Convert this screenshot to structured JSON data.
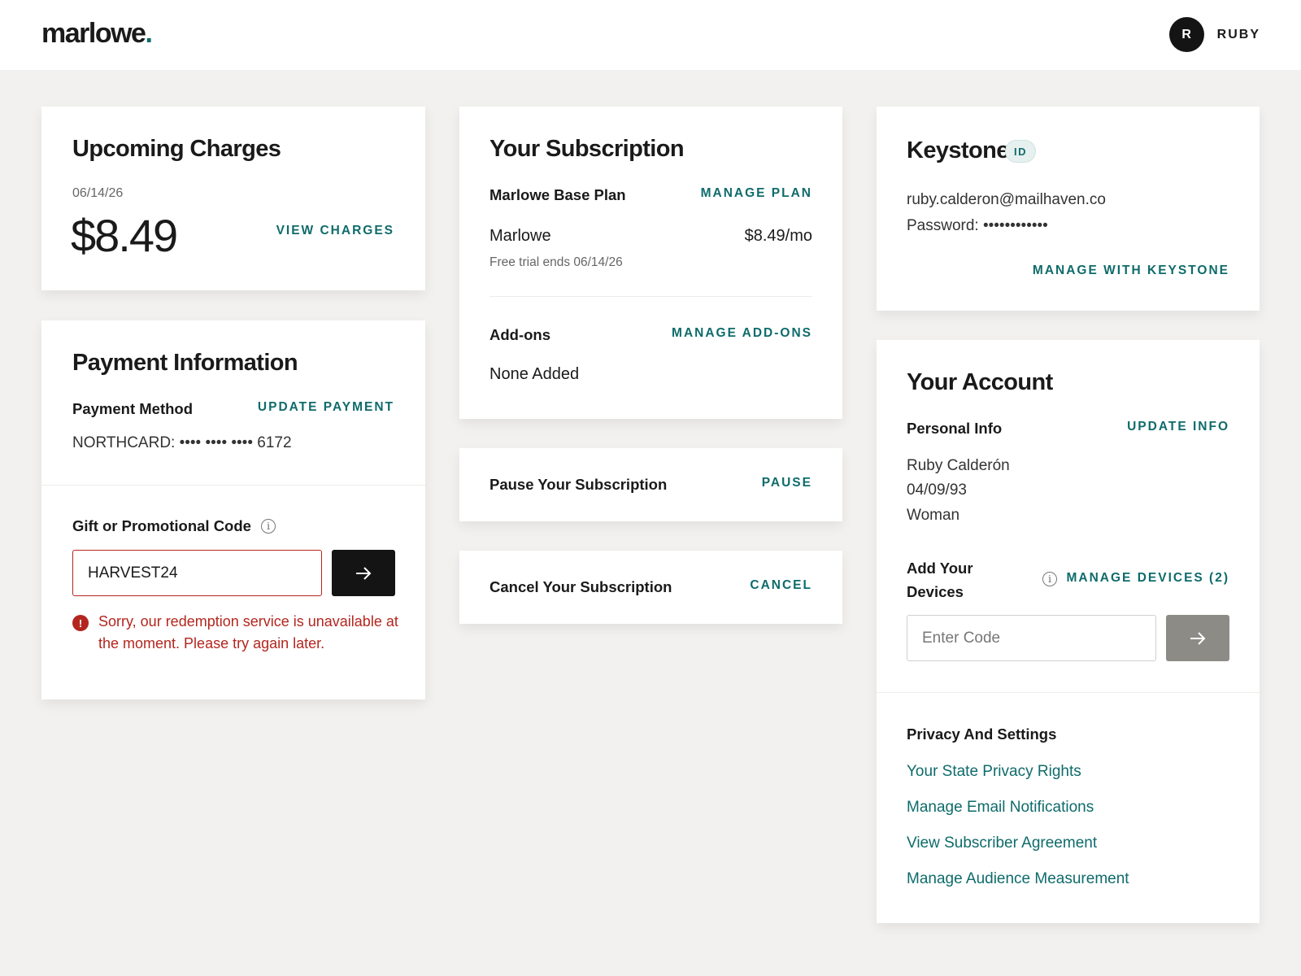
{
  "header": {
    "logo_text": "marlowe",
    "logo_dot": ".",
    "avatar_initial": "R",
    "user_name": "RUBY"
  },
  "upcoming_charges": {
    "title": "Upcoming Charges",
    "date": "06/14/26",
    "amount": "$8.49",
    "view_charges": "VIEW CHARGES"
  },
  "payment": {
    "title": "Payment Information",
    "method_label": "Payment Method",
    "update_payment": "UPDATE PAYMENT",
    "card_text": "NORTHCARD: •••• •••• •••• 6172",
    "promo_label": "Gift or Promotional Code",
    "promo_value": "HARVEST24",
    "error_message": "Sorry, our redemption service is unavailable at the moment. Please try again later."
  },
  "subscription": {
    "title": "Your Subscription",
    "plan_label": "Marlowe Base Plan",
    "manage_plan": "MANAGE PLAN",
    "plan_name": "Marlowe",
    "plan_price": "$8.49/mo",
    "trial_note": "Free trial ends 06/14/26",
    "addons_label": "Add-ons",
    "manage_addons": "MANAGE ADD-ONS",
    "addons_value": "None Added"
  },
  "pause": {
    "label": "Pause Your Subscription",
    "action": "PAUSE"
  },
  "cancel": {
    "label": "Cancel Your Subscription",
    "action": "CANCEL"
  },
  "keystone": {
    "title": "Keystone",
    "badge": "ID",
    "email": "ruby.calderon@mailhaven.co",
    "password": "Password: ••••••••••••",
    "manage": "MANAGE WITH KEYSTONE"
  },
  "account": {
    "title": "Your Account",
    "personal_label": "Personal Info",
    "update_info": "UPDATE INFO",
    "name": "Ruby Calderón",
    "dob": "04/09/93",
    "gender": "Woman",
    "devices_label_line1": "Add Your",
    "devices_label_line2": "Devices",
    "manage_devices": "MANAGE DEVICES (2)",
    "code_placeholder": "Enter Code",
    "privacy_label": "Privacy And Settings",
    "privacy_links": [
      "Your State Privacy Rights",
      "Manage Email Notifications",
      "View Subscriber Agreement",
      "Manage Audience Measurement"
    ]
  },
  "colors": {
    "accent": "#0f6b6b",
    "error": "#b3261e",
    "background": "#f2f1ef"
  }
}
